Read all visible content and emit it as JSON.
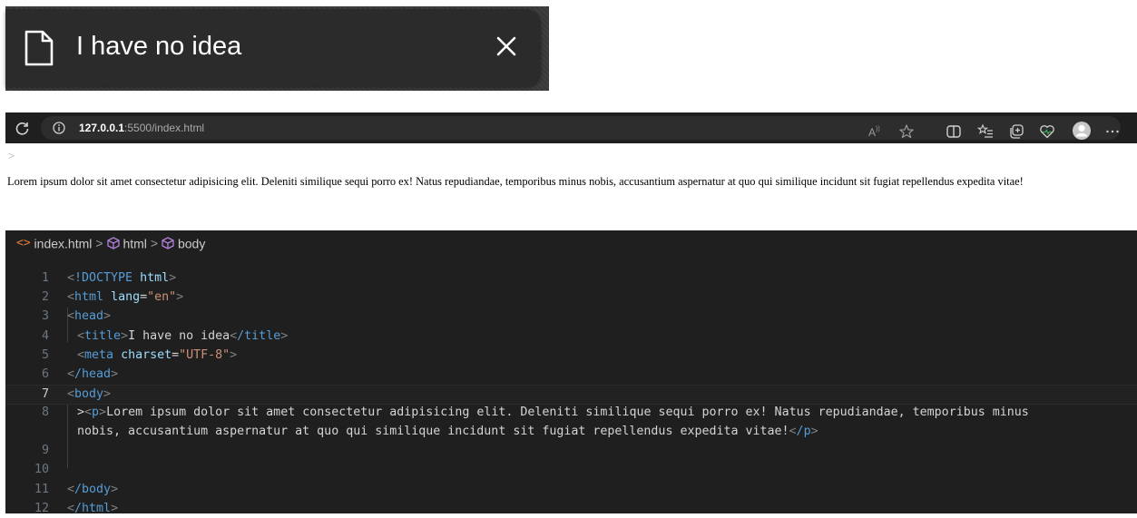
{
  "tab": {
    "title": "I have no idea",
    "icon": "page-icon",
    "close_icon": "close-icon"
  },
  "address_bar": {
    "url_host": "127.0.0.1",
    "url_rest": ":5500/index.html",
    "toolbar_icons": [
      "read-aloud-icon",
      "favorite-star-icon",
      "split-screen-icon",
      "favorites-list-icon",
      "collections-icon",
      "browser-essentials-icon",
      "profile-avatar-icon",
      "more-options-icon"
    ]
  },
  "rendered_page": {
    "caret": ">",
    "paragraph": "Lorem ipsum dolor sit amet consectetur adipisicing elit. Deleniti similique sequi porro ex! Natus repudiandae, temporibus minus nobis, accusantium aspernatur at quo qui similique incidunt sit fugiat repellendus expedita vitae!"
  },
  "editor": {
    "breadcrumb": [
      "index.html",
      "html",
      "body"
    ],
    "active_line": 7,
    "lines": [
      {
        "n": "1",
        "text": "<!DOCTYPE html>"
      },
      {
        "n": "2",
        "text": "<html lang=\"en\">"
      },
      {
        "n": "3",
        "text": "<head>"
      },
      {
        "n": "4",
        "text": "<title>I have no idea</title>"
      },
      {
        "n": "5",
        "text": "<meta charset=\"UTF-8\">"
      },
      {
        "n": "6",
        "text": "</head>"
      },
      {
        "n": "7",
        "text": "<body>"
      },
      {
        "n": "8",
        "text": "><p>Lorem ipsum dolor sit amet consectetur adipisicing elit. Deleniti similique sequi porro ex! Natus repudiandae, temporibus minus"
      },
      {
        "n": "",
        "text": "nobis, accusantium aspernatur at quo qui similique incidunt sit fugiat repellendus expedita vitae!</p>"
      },
      {
        "n": "9",
        "text": ""
      },
      {
        "n": "10",
        "text": ""
      },
      {
        "n": "11",
        "text": "</body>"
      },
      {
        "n": "12",
        "text": "</html>"
      }
    ]
  },
  "colors": {
    "tag": "#569cd6",
    "attribute": "#9cdcfe",
    "string": "#ce9178",
    "bracket": "#808080",
    "editor_bg": "#1f1f1f"
  }
}
